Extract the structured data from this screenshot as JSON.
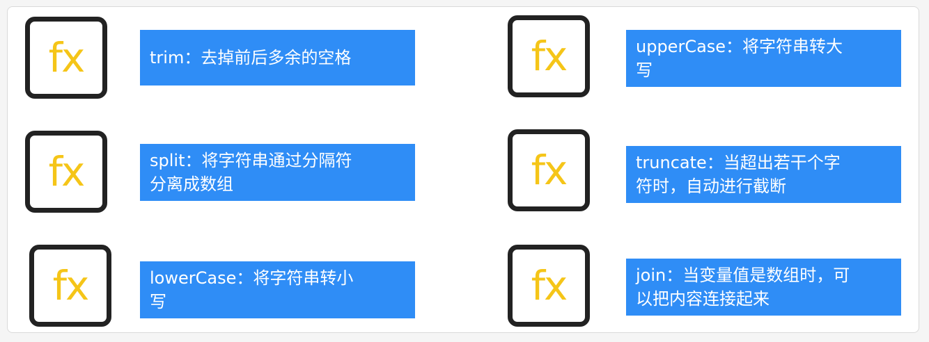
{
  "functions": [
    {
      "icon": "fx",
      "text": "trim：去掉前后多余的空格"
    },
    {
      "icon": "fx",
      "text": "upperCase：将字符串转大\n写"
    },
    {
      "icon": "fx",
      "text": "split：将字符串通过分隔符\n分离成数组"
    },
    {
      "icon": "fx",
      "text": "truncate：当超出若干个字\n符时，自动进行截断"
    },
    {
      "icon": "fx",
      "text": "lowerCase：将字符串转小\n写"
    },
    {
      "icon": "fx",
      "text": "join：当变量值是数组时，可\n以把内容连接起来"
    }
  ],
  "colors": {
    "label_background": "#2f8df6",
    "icon_glyph": "#f5c518",
    "icon_border": "#222222"
  }
}
